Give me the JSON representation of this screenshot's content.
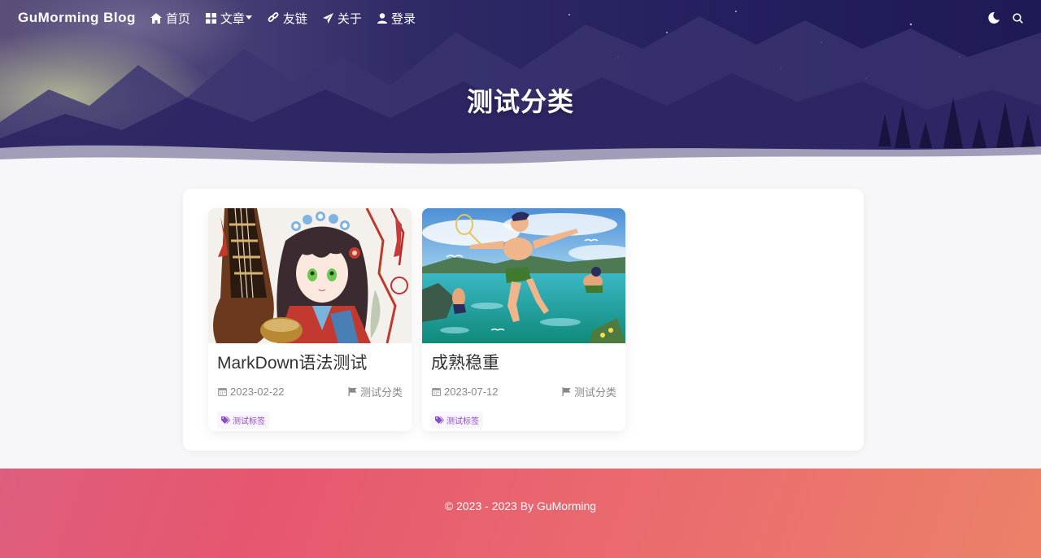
{
  "nav": {
    "brand": "GuMorming Blog",
    "items": [
      {
        "label": "首页",
        "icon": "home-icon"
      },
      {
        "label": "文章",
        "icon": "grid-icon",
        "has_dropdown": true
      },
      {
        "label": "友链",
        "icon": "link-icon"
      },
      {
        "label": "关于",
        "icon": "paper-plane-icon"
      },
      {
        "label": "登录",
        "icon": "user-icon"
      }
    ],
    "right_icons": [
      "dark-mode-icon",
      "search-icon"
    ]
  },
  "hero": {
    "title": "测试分类"
  },
  "posts": [
    {
      "title": "MarkDown语法测试",
      "date": "2023-02-22",
      "category": "测试分类",
      "tag": "测试标签",
      "cover": "anime-girl-with-pipa-illustration"
    },
    {
      "title": "成熟稳重",
      "date": "2023-07-12",
      "category": "测试分类",
      "tag": "测试标签",
      "cover": "boys-jumping-into-sea-illustration"
    }
  ],
  "footer": {
    "text": "© 2023 - 2023 By GuMorming"
  },
  "colors": {
    "tag_text": "#8a4dc5",
    "tag_bg": "#faf5fd",
    "footer_start": "#dd5e7d",
    "footer_end": "#ec8168",
    "hero_dark": "#241f5e"
  }
}
